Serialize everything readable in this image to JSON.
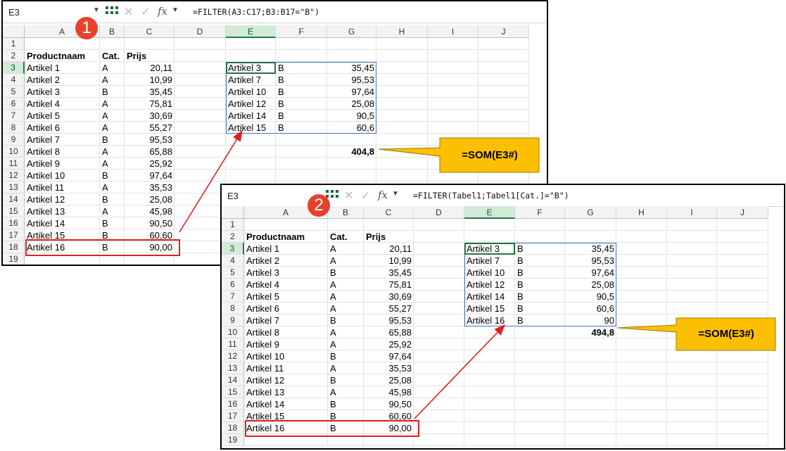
{
  "columns": [
    "A",
    "B",
    "C",
    "D",
    "E",
    "F",
    "G",
    "H",
    "I",
    "J"
  ],
  "rows": [
    "1",
    "2",
    "3",
    "4",
    "5",
    "6",
    "7",
    "8",
    "9",
    "10",
    "11",
    "12",
    "13",
    "14",
    "15",
    "16",
    "17",
    "18",
    "19"
  ],
  "source_table": {
    "headers": [
      "Productnaam",
      "Cat.",
      "Prijs"
    ],
    "rows": [
      [
        "Artikel 1",
        "A",
        "20,11"
      ],
      [
        "Artikel 2",
        "A",
        "10,99"
      ],
      [
        "Artikel 3",
        "B",
        "35,45"
      ],
      [
        "Artikel 4",
        "A",
        "75,81"
      ],
      [
        "Artikel 5",
        "A",
        "30,69"
      ],
      [
        "Artikel 6",
        "A",
        "55,27"
      ],
      [
        "Artikel 7",
        "B",
        "95,53"
      ],
      [
        "Artikel 8",
        "A",
        "65,88"
      ],
      [
        "Artikel 9",
        "A",
        "25,92"
      ],
      [
        "Artikel 10",
        "B",
        "97,64"
      ],
      [
        "Artikel 11",
        "A",
        "35,53"
      ],
      [
        "Artikel 12",
        "B",
        "25,08"
      ],
      [
        "Artikel 13",
        "A",
        "45,98"
      ],
      [
        "Artikel 14",
        "B",
        "90,50"
      ],
      [
        "Artikel 15",
        "B",
        "60,60"
      ],
      [
        "Artikel 16",
        "B",
        "90,00"
      ]
    ]
  },
  "window1": {
    "badge": "1",
    "name_box": "E3",
    "formula": "=FILTER(A3:C17;B3:B17=\"B\")",
    "filter_result": [
      [
        "Artikel 3",
        "B",
        "35,45"
      ],
      [
        "Artikel 7",
        "B",
        "95,53"
      ],
      [
        "Artikel 10",
        "B",
        "97,64"
      ],
      [
        "Artikel 12",
        "B",
        "25,08"
      ],
      [
        "Artikel 14",
        "B",
        "90,5"
      ],
      [
        "Artikel 15",
        "B",
        "60,6"
      ]
    ],
    "sum": "404,8",
    "callout": "=SOM(E3#)"
  },
  "window2": {
    "badge": "2",
    "name_box": "E3",
    "formula": "=FILTER(Tabel1;Tabel1[Cat.]=\"B\")",
    "filter_result": [
      [
        "Artikel 3",
        "B",
        "35,45"
      ],
      [
        "Artikel 7",
        "B",
        "95,53"
      ],
      [
        "Artikel 10",
        "B",
        "97,64"
      ],
      [
        "Artikel 12",
        "B",
        "25,08"
      ],
      [
        "Artikel 14",
        "B",
        "90,5"
      ],
      [
        "Artikel 15",
        "B",
        "60,6"
      ],
      [
        "Artikel 16",
        "B",
        "90"
      ]
    ],
    "sum": "494,8",
    "callout": "=SOM(E3#)"
  },
  "colors": {
    "table_header": "#70ad47",
    "band": "#d9d9d9",
    "highlight": "#e01f1f",
    "callout": "#fcc000",
    "badge": "#e8402a",
    "selection": "#217346",
    "spill_border": "#4472c4"
  },
  "icons": [
    "chevron-down-icon",
    "spill-dots-icon",
    "cancel-x-icon",
    "enter-check-icon",
    "function-fx-icon",
    "filter-dropdown-icon"
  ]
}
